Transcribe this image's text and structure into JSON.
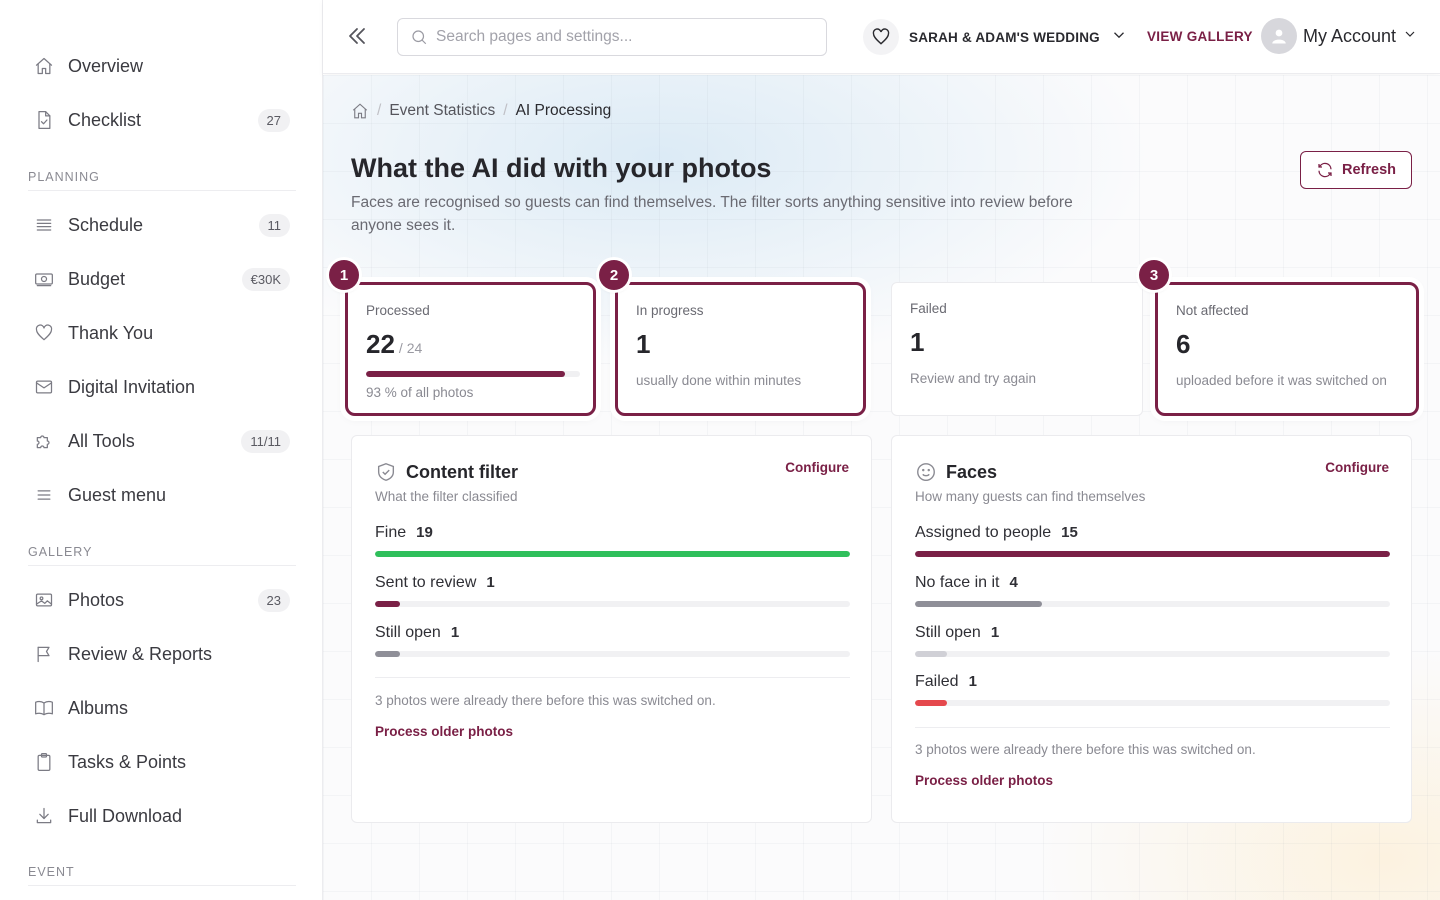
{
  "sidebar": {
    "items": [
      {
        "label": "Overview",
        "icon": "home-icon",
        "badge": ""
      },
      {
        "label": "Checklist",
        "icon": "checklist-icon",
        "badge": "27"
      },
      {
        "label": "Schedule",
        "icon": "list-icon",
        "badge": "11"
      },
      {
        "label": "Budget",
        "icon": "money-icon",
        "badge": "€30K"
      },
      {
        "label": "Thank You",
        "icon": "heart-icon",
        "badge": ""
      },
      {
        "label": "Digital Invitation",
        "icon": "mail-icon",
        "badge": ""
      },
      {
        "label": "All Tools",
        "icon": "puzzle-icon",
        "badge": "11/11"
      },
      {
        "label": "Guest menu",
        "icon": "menu-icon",
        "badge": ""
      },
      {
        "label": "Photos",
        "icon": "image-icon",
        "badge": "23"
      },
      {
        "label": "Review & Reports",
        "icon": "flag-icon",
        "badge": ""
      },
      {
        "label": "Albums",
        "icon": "book-icon",
        "badge": ""
      },
      {
        "label": "Tasks & Points",
        "icon": "clipboard-icon",
        "badge": ""
      },
      {
        "label": "Full Download",
        "icon": "download-icon",
        "badge": ""
      }
    ],
    "sections": {
      "planning": "PLANNING",
      "gallery": "GALLERY",
      "event": "EVENT"
    }
  },
  "topbar": {
    "search_placeholder": "Search pages and settings...",
    "event_name": "SARAH & ADAM'S WEDDING",
    "view_gallery": "VIEW GALLERY",
    "account": "My Account"
  },
  "breadcrumb": {
    "parent": "Event Statistics",
    "current": "AI Processing"
  },
  "page": {
    "title": "What the AI did with your photos",
    "subtitle": "Faces are recognised so guests can find themselves. The filter sorts anything sensitive into review before anyone sees it.",
    "refresh": "Refresh"
  },
  "stats": {
    "processed": {
      "step": "1",
      "label": "Processed",
      "value": "22",
      "of": "/ 24",
      "percent_text": "93 % of all photos",
      "progress": 0.93
    },
    "in_progress": {
      "step": "2",
      "label": "In progress",
      "value": "1",
      "note": "usually done within minutes"
    },
    "failed": {
      "label": "Failed",
      "value": "1",
      "note": "Review and try again"
    },
    "not_affected": {
      "step": "3",
      "label": "Not affected",
      "value": "6",
      "note": "uploaded before it was switched on"
    }
  },
  "content_filter": {
    "title": "Content filter",
    "configure": "Configure",
    "subtitle": "What the filter classified",
    "rows": [
      {
        "label": "Fine",
        "value": "19",
        "fraction": 1.0,
        "color": "#2fbf5b"
      },
      {
        "label": "Sent to review",
        "value": "1",
        "fraction": 0.053,
        "color": "#7a2046"
      },
      {
        "label": "Still open",
        "value": "1",
        "fraction": 0.053,
        "color": "#8f8f98"
      }
    ],
    "note": "3 photos were already there before this was switched on.",
    "link": "Process older photos"
  },
  "faces": {
    "title": "Faces",
    "configure": "Configure",
    "subtitle": "How many guests can find themselves",
    "rows": [
      {
        "label": "Assigned to people",
        "value": "15",
        "fraction": 1.0,
        "color": "#7a2046"
      },
      {
        "label": "No face in it",
        "value": "4",
        "fraction": 0.267,
        "color": "#8f8f98"
      },
      {
        "label": "Still open",
        "value": "1",
        "fraction": 0.067,
        "color": "#d0d0d6"
      },
      {
        "label": "Failed",
        "value": "1",
        "fraction": 0.067,
        "color": "#e5484d"
      }
    ],
    "note": "3 photos were already there before this was switched on.",
    "link": "Process older photos"
  }
}
